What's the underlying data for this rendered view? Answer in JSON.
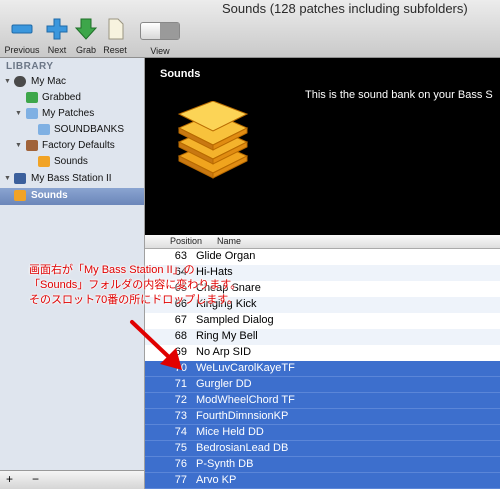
{
  "window": {
    "title": "Sounds (128 patches including subfolders)"
  },
  "toolbar": {
    "previous": "Previous",
    "next": "Next",
    "grab": "Grab",
    "reset": "Reset",
    "view": "View"
  },
  "sidebar": {
    "header": "LIBRARY",
    "items": [
      {
        "label": "My Mac"
      },
      {
        "label": "Grabbed"
      },
      {
        "label": "My Patches"
      },
      {
        "label": "SOUNDBANKS"
      },
      {
        "label": "Factory Defaults"
      },
      {
        "label": "Sounds"
      },
      {
        "label": "My Bass Station II"
      },
      {
        "label": "Sounds"
      }
    ],
    "bottom": {
      "add": "+",
      "remove": "−"
    }
  },
  "panel": {
    "title": "Sounds",
    "description": "This is the sound bank on your Bass S"
  },
  "table": {
    "columns": {
      "position": "Position",
      "name": "Name"
    },
    "rows": [
      {
        "pos": "63",
        "name": "Glide Organ"
      },
      {
        "pos": "64",
        "name": "Hi-Hats"
      },
      {
        "pos": "65",
        "name": "Cheap Snare"
      },
      {
        "pos": "66",
        "name": "Kinging Kick"
      },
      {
        "pos": "67",
        "name": "Sampled Dialog"
      },
      {
        "pos": "68",
        "name": "Ring My Bell"
      },
      {
        "pos": "69",
        "name": "No Arp SID"
      },
      {
        "pos": "70",
        "name": "WeLuvCarolKayeTF"
      },
      {
        "pos": "71",
        "name": "Gurgler DD"
      },
      {
        "pos": "72",
        "name": "ModWheelChord TF"
      },
      {
        "pos": "73",
        "name": "FourthDimnsionKP"
      },
      {
        "pos": "74",
        "name": "Mice Held DD"
      },
      {
        "pos": "75",
        "name": "BedrosianLead DB"
      },
      {
        "pos": "76",
        "name": "P-Synth DB"
      },
      {
        "pos": "77",
        "name": "Arvo KP"
      }
    ]
  },
  "annotation": {
    "line1": "画面右が「My Bass Station II」の",
    "line2": "「Sounds」フォルダの内容に変わります。",
    "line3": "そのスロット70番の所にドロップします。"
  },
  "colors": {
    "selection": "#3d6fcd",
    "annotation": "#e00000",
    "sidebar": "#dfe5ee"
  }
}
